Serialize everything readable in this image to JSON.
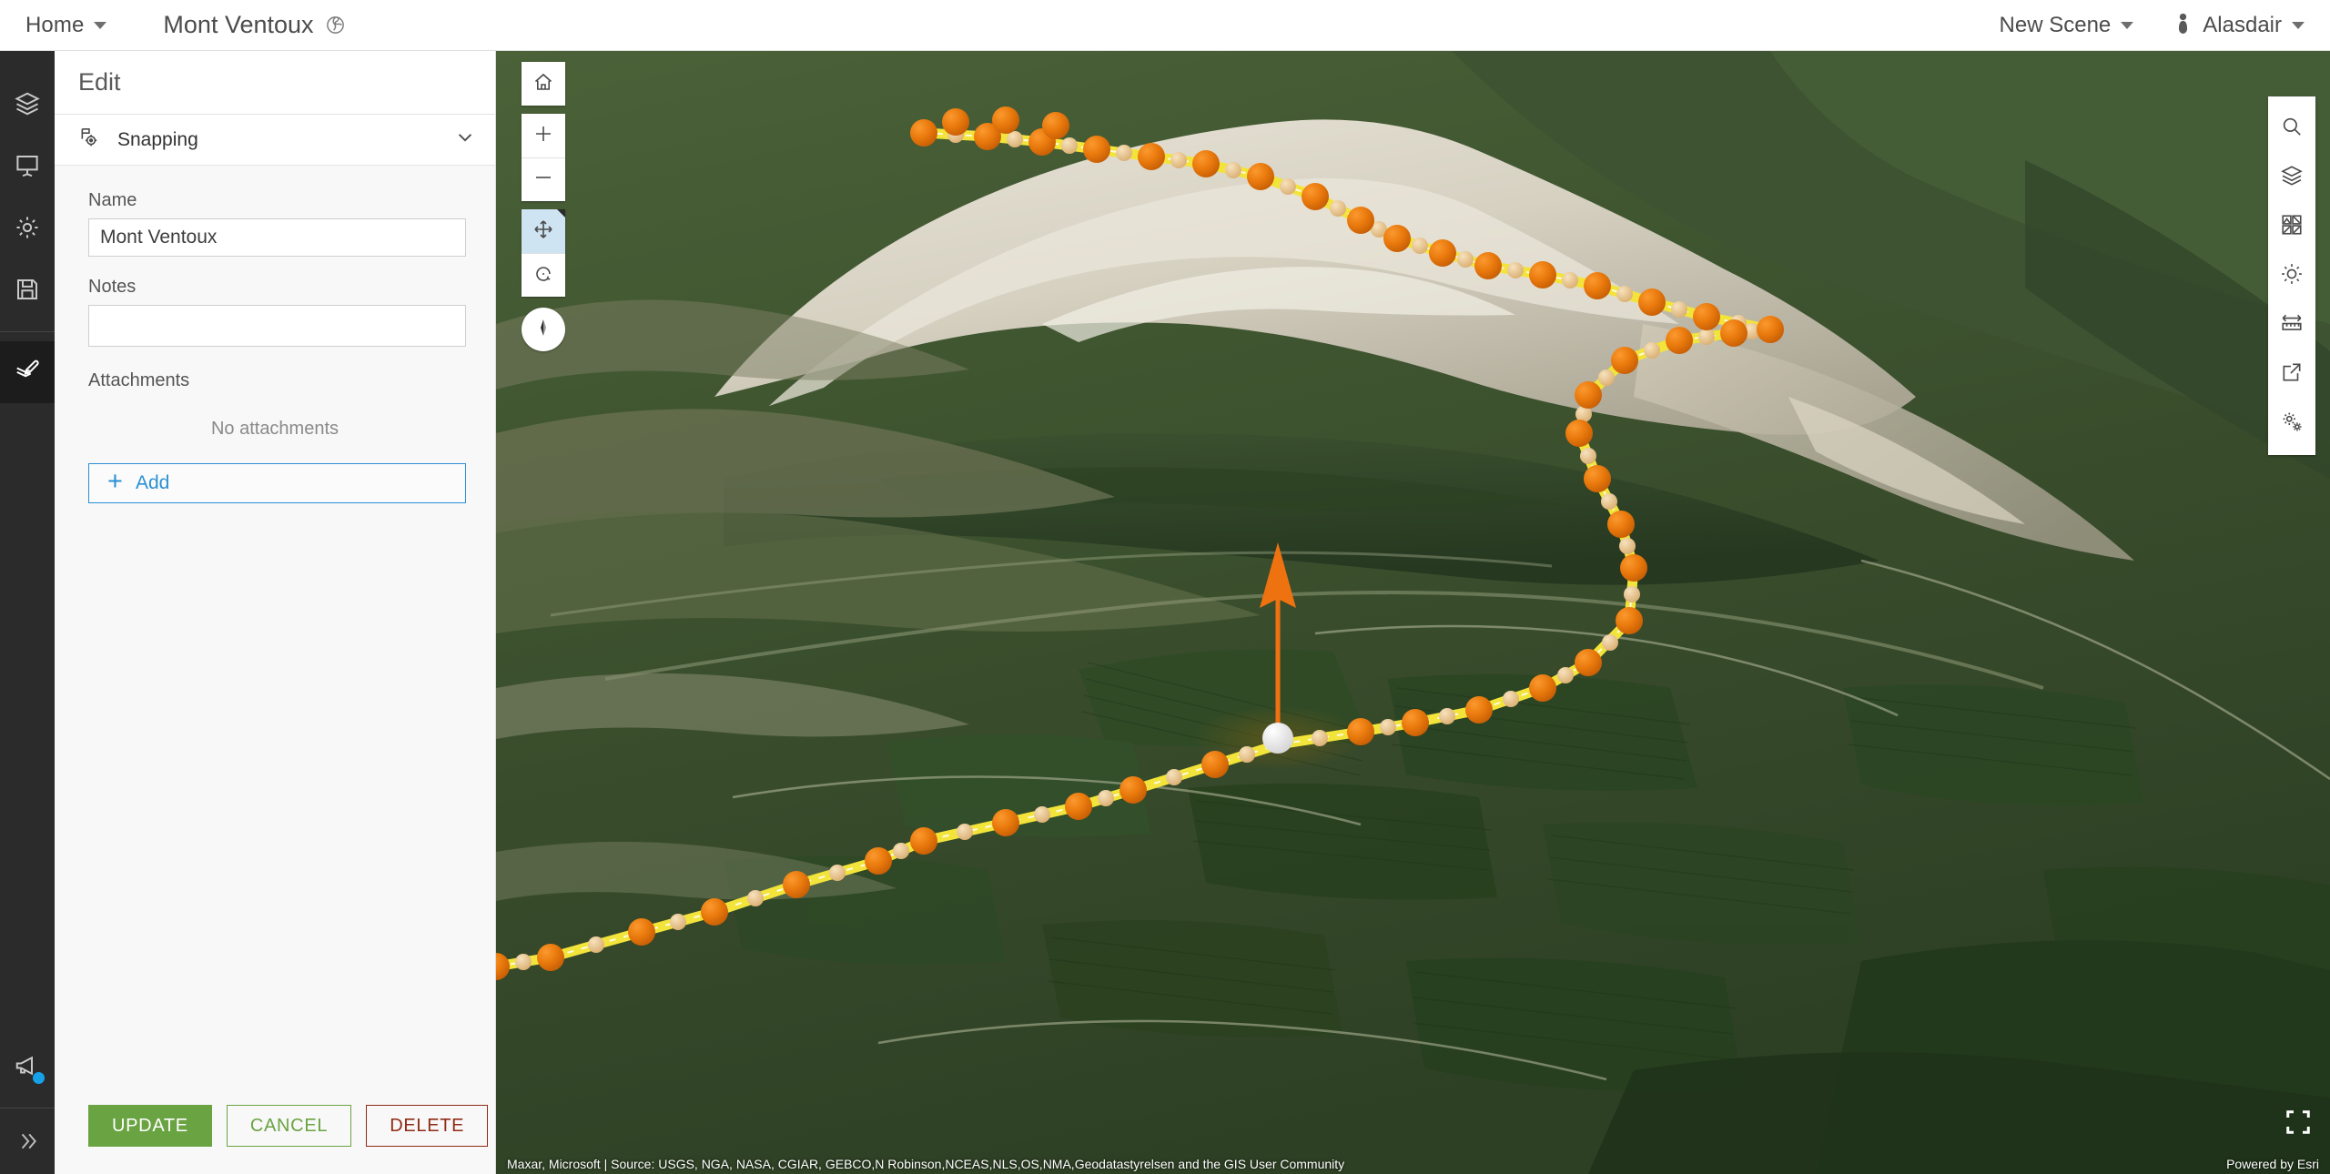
{
  "header": {
    "home_label": "Home",
    "home_caret_icon": "chevron-down-icon",
    "scene_title": "Mont Ventoux",
    "scene_icon": "globe-icon",
    "scene_menu_label": "New Scene",
    "scene_menu_caret_icon": "chevron-down-icon",
    "user_icon": "user-avatar-icon",
    "user_label": "Alasdair",
    "user_caret_icon": "chevron-down-icon"
  },
  "rail": {
    "items": [
      {
        "name": "layers",
        "icon": "layers-icon",
        "active": false
      },
      {
        "name": "slides",
        "icon": "presentation-icon",
        "active": false
      },
      {
        "name": "settings",
        "icon": "gear-icon",
        "active": false
      },
      {
        "name": "save",
        "icon": "floppy-save-icon",
        "active": false
      },
      {
        "name": "edit",
        "icon": "edit-layers-icon",
        "active": true
      }
    ],
    "announcement_icon": "megaphone-icon",
    "has_notification": true,
    "expand_icon": "chevrons-right-icon"
  },
  "panel": {
    "title": "Edit",
    "snapping": {
      "label": "Snapping",
      "icon": "snapping-icon",
      "chevron_icon": "chevron-down-icon",
      "expanded": false
    },
    "name_label": "Name",
    "name_value": "Mont Ventoux",
    "name_placeholder": "",
    "notes_label": "Notes",
    "notes_value": "",
    "notes_placeholder": "",
    "attachments_label": "Attachments",
    "no_attachments_text": "No attachments",
    "add_label": "Add",
    "add_icon": "plus-icon",
    "update_label": "UPDATE",
    "cancel_label": "CANCEL",
    "delete_label": "DELETE"
  },
  "map_controls": {
    "home": {
      "label": "Home",
      "icon": "home-icon"
    },
    "zoom_in": {
      "label": "Zoom in",
      "icon": "plus-icon"
    },
    "zoom_out": {
      "label": "Zoom out",
      "icon": "minus-icon"
    },
    "pan": {
      "label": "Pan",
      "icon": "pan-arrows-icon",
      "selected": true
    },
    "rotate": {
      "label": "Rotate",
      "icon": "rotate-icon",
      "selected": false
    },
    "compass": {
      "label": "Compass",
      "icon": "compass-needle-icon"
    }
  },
  "map_tools": [
    {
      "name": "search",
      "icon": "search-icon"
    },
    {
      "name": "layers",
      "icon": "layers-icon"
    },
    {
      "name": "basemap-gallery",
      "icon": "basemap-grid-icon"
    },
    {
      "name": "daylight",
      "icon": "sun-icon"
    },
    {
      "name": "measure",
      "icon": "measure-icon"
    },
    {
      "name": "share",
      "icon": "share-icon"
    },
    {
      "name": "settings",
      "icon": "gears-icon"
    }
  ],
  "map": {
    "fullscreen_icon": "fullscreen-icon",
    "attribution": "Maxar, Microsoft | Source: USGS, NGA, NASA, CGIAR, GEBCO,N Robinson,NCEAS,NLS,OS,NMA,Geodatastyrelsen and the GIS User Community",
    "powered_by": "Powered by Esri"
  },
  "colors": {
    "accent_blue": "#2a8fd4",
    "update_green": "#6aa342",
    "delete_red": "#8f2b14",
    "rail_dark": "#2b2b2b",
    "notification_blue": "#16a2e8",
    "route_line": "#f2e43a",
    "route_vertex": "#e8740c",
    "route_midpoint": "#e8c48a",
    "selected_vertex": "#ffffff",
    "z_handle": "#ef7211"
  },
  "route": {
    "type": "polyline-3d",
    "vertex_count": 86,
    "selected_vertex_index": 44,
    "description": "Mont Ventoux cycling ascent route with orange vertex spheres, tan midpoint handles, and a yellow route line; the selected vertex shows a white sphere with a vertical orange Z-translate arrow."
  }
}
